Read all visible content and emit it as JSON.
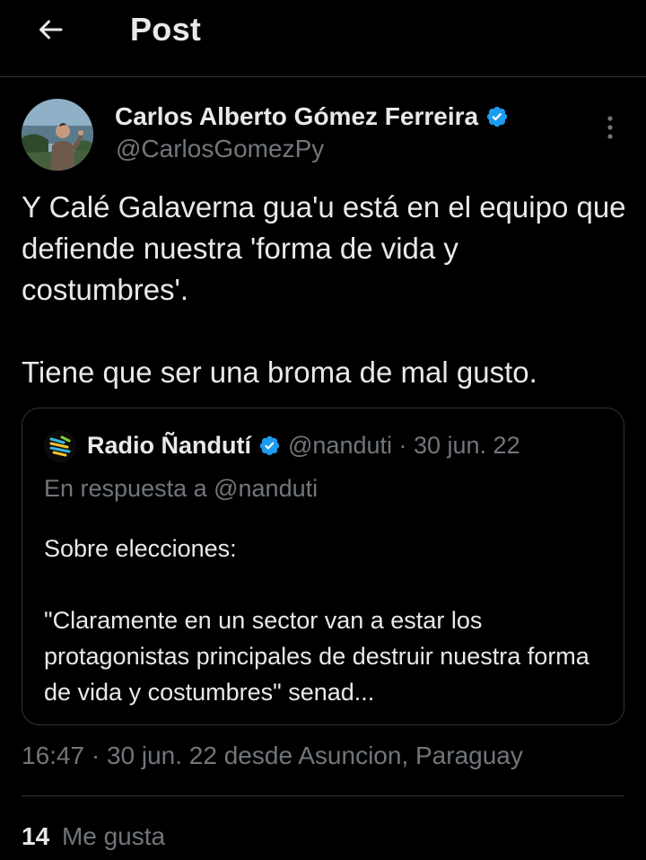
{
  "header": {
    "title": "Post",
    "back_icon": "arrow-left-icon"
  },
  "author": {
    "name": "Carlos Alberto Gómez Ferreira",
    "handle": "@CarlosGomezPy",
    "verified": true,
    "badge_color": "#1d9bf0"
  },
  "tweet": {
    "paragraphs": [
      "Y Calé Galaverna gua'u está en el equipo que defiende nuestra 'forma de vida y costumbres'.",
      "Tiene que ser una broma de mal gusto."
    ]
  },
  "quote": {
    "name": "Radio Ñandutí",
    "verified": true,
    "meta": "@nanduti · 30 jun. 22",
    "reply_to": "En respuesta a @nanduti",
    "paragraphs": [
      "Sobre elecciones:",
      "\"Claramente en un sector van a estar los protagonistas principales de destruir nuestra forma de vida y costumbres\" senad..."
    ]
  },
  "meta": {
    "timestamp": "16:47 · 30 jun. 22 desde Asuncion, Paraguay"
  },
  "stats": {
    "likes_count": "14",
    "likes_label": "Me gusta"
  },
  "colors": {
    "background": "#000000",
    "text": "#e7e9ea",
    "secondary": "#71767b",
    "border": "#2f3336",
    "accent": "#1d9bf0"
  }
}
